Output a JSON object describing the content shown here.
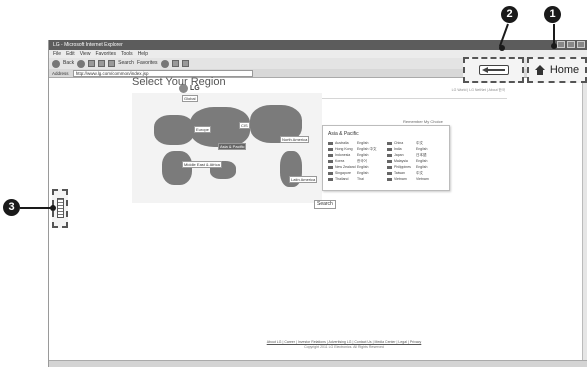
{
  "browser": {
    "title": "LG - Microsoft Internet Explorer",
    "menu": [
      "File",
      "Edit",
      "View",
      "Favorites",
      "Tools",
      "Help"
    ],
    "toolbar": {
      "back": "Back",
      "search": "Search",
      "favorites": "Favorites"
    },
    "address_label": "Address",
    "address_url": "http://www.lg.com/common/index.jsp"
  },
  "site": {
    "logo_text": "LG",
    "tagline": "Life's Good",
    "top_links": "LG World | LG NetNet | About 한국"
  },
  "region": {
    "title": "Select Your Region",
    "remember": "Remember My Choice",
    "search_button": "Search",
    "map_labels": {
      "global": "Global",
      "europe": "Europe",
      "cis": "CIS",
      "north_america": "North America",
      "asia_pacific": "Asia & Pacific",
      "middle_east_africa": "Middle East & Africa",
      "latin_america": "Latin America"
    }
  },
  "asia_pacific": {
    "title": "Asia & Pacific",
    "rows": [
      {
        "country": "Australia",
        "lang": "English"
      },
      {
        "country": "China",
        "lang": "中文"
      },
      {
        "country": "Hong Kong",
        "lang": "English  中文"
      },
      {
        "country": "India",
        "lang": "English"
      },
      {
        "country": "Indonesia",
        "lang": "English"
      },
      {
        "country": "Japan",
        "lang": "日本語"
      },
      {
        "country": "Korea",
        "lang": "한국어"
      },
      {
        "country": "Malaysia",
        "lang": "English"
      },
      {
        "country": "New Zealand",
        "lang": "English"
      },
      {
        "country": "Philippines",
        "lang": "English"
      },
      {
        "country": "Singapore",
        "lang": "English"
      },
      {
        "country": "Taiwan",
        "lang": "中文"
      },
      {
        "country": "Thailand",
        "lang": "Thai"
      },
      {
        "country": "Vietnam",
        "lang": "Vietnam"
      }
    ]
  },
  "footer": {
    "links": "About LG | Career | Investor Relations | Advertising LG | Contact Us | Media Center | Legal | Privacy",
    "copyright": "Copyright 2011 LG Electronics. All Rights Reserved"
  },
  "callouts": {
    "home": "1",
    "back": "2",
    "side": "3",
    "home_label": "Home"
  },
  "icons": [
    "back-arrow-icon",
    "home-icon",
    "scroll-wheel-icon",
    "lg-logo-icon"
  ]
}
